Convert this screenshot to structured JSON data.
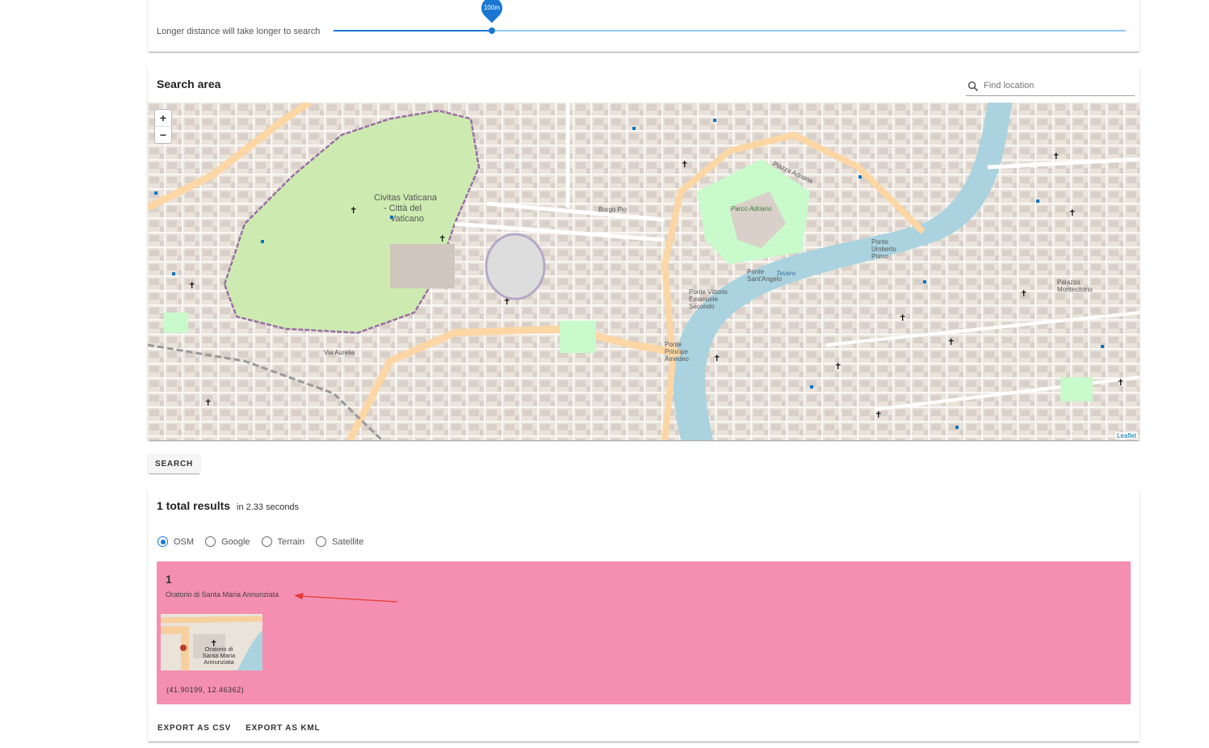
{
  "slider": {
    "hint": "Longer distance will take longer to search",
    "value_label": "100m",
    "fraction": 0.2
  },
  "search_area": {
    "title": "Search area",
    "find_placeholder": "Find location",
    "zoom_in": "+",
    "zoom_out": "−",
    "attribution": "Leaflet",
    "map_labels": {
      "vatican": "Civitas Vaticana",
      "vatican2": "- Città del",
      "vatican3": "Vaticano",
      "parco": "Parco Adriano",
      "ponte_angelo": "Ponte Sant'Angelo",
      "ponte_vittorio": "Ponte Vittorio Emanuele Secondo",
      "ponte_amedeo": "Ponte Principe Amedeo",
      "ponte_umberto": "Ponte Umberto Primo",
      "tevere": "Tevere",
      "palazzo": "Palazzo Montecitorio",
      "piazza_adriana": "Piazza Adriana",
      "borgo_pio": "Borgo Pio",
      "via_aurelia": "Via Aurelia"
    },
    "search_button": "SEARCH"
  },
  "results": {
    "title": "1 total results",
    "time": "in 2.33 seconds",
    "map_types": [
      {
        "label": "OSM",
        "checked": true
      },
      {
        "label": "Google",
        "checked": false
      },
      {
        "label": "Terrain",
        "checked": false
      },
      {
        "label": "Satellite",
        "checked": false
      }
    ],
    "items": [
      {
        "number": "1",
        "name": "Oratorio di Santa Maria Annunziata",
        "thumb_label": "Oratorio di Santa Maria Annunziata",
        "coords": "(41.90199, 12.46362)"
      }
    ],
    "export_csv": "EXPORT AS CSV",
    "export_kml": "EXPORT AS KML"
  },
  "colors": {
    "accent": "#1976d2",
    "result_bg": "#f48fb1",
    "river": "#aad3df",
    "park": "#c8facc",
    "major_road": "#fcd6a4",
    "annotation_arrow": "#e53935"
  }
}
